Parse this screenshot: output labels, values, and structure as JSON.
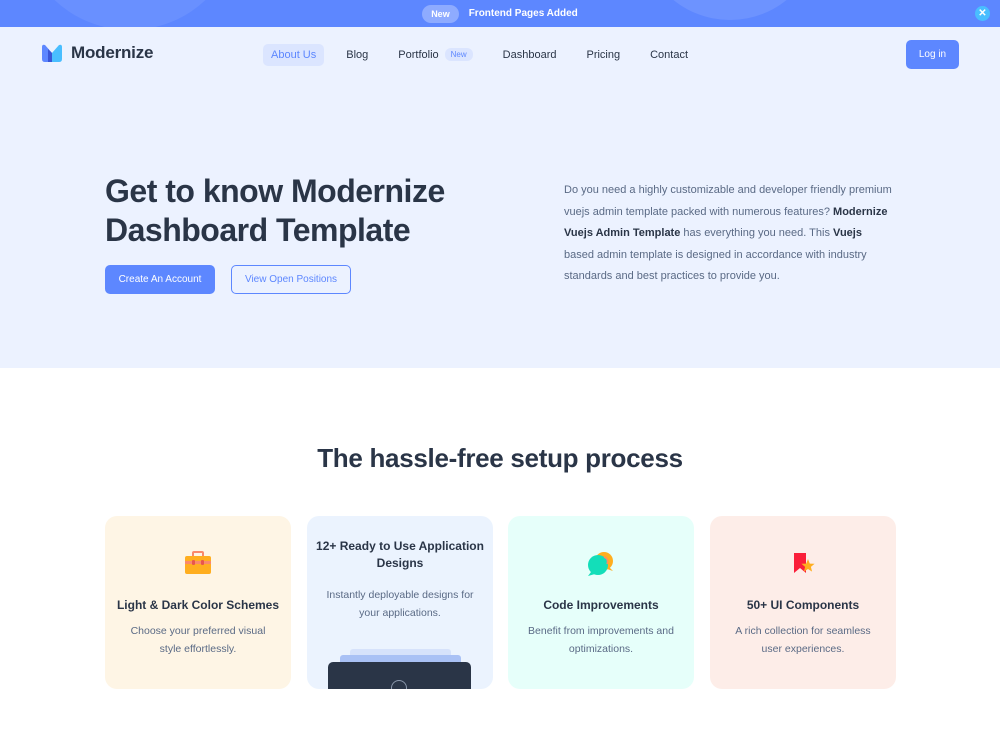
{
  "banner": {
    "badge": "New",
    "text": "Frontend Pages Added",
    "close_symbol": "✕"
  },
  "header": {
    "logo_text": "Modernize",
    "nav": [
      {
        "label": "About Us",
        "active": true
      },
      {
        "label": "Blog"
      },
      {
        "label": "Portfolio",
        "badge": "New"
      },
      {
        "label": "Dashboard"
      },
      {
        "label": "Pricing"
      },
      {
        "label": "Contact"
      }
    ],
    "login_label": "Log in"
  },
  "hero": {
    "title_line1": "Get to know Modernize",
    "title_line2": "Dashboard Template",
    "primary_button": "Create An Account",
    "secondary_button": "View Open Positions",
    "desc_part1": "Do you need a highly customizable and developer friendly premium vuejs admin template packed with numerous features? ",
    "desc_bold1": "Modernize Vuejs Admin Template",
    "desc_part2": " has everything you need. This ",
    "desc_bold2": "Vuejs",
    "desc_part3": " based admin template is designed in accordance with industry standards and best practices to provide you."
  },
  "features": {
    "title": "The hassle-free setup process",
    "cards": [
      {
        "icon": "briefcase-icon",
        "title": "Light & Dark Color Schemes",
        "desc": "Choose your preferred visual style effortlessly."
      },
      {
        "icon": "app-preview",
        "title": "12+ Ready to Use Application Designs",
        "desc": "Instantly deployable designs for your applications."
      },
      {
        "icon": "chat-bubbles-icon",
        "title": "Code Improvements",
        "desc": "Benefit from improvements and optimizations."
      },
      {
        "icon": "star-badge-icon",
        "title": "50+ UI Components",
        "desc": "A rich collection for seamless user experiences."
      }
    ]
  },
  "colors": {
    "primary": "#5d87ff",
    "hero_bg": "#ecf2ff",
    "text_dark": "#2a3547",
    "text_muted": "#5a6a85"
  }
}
